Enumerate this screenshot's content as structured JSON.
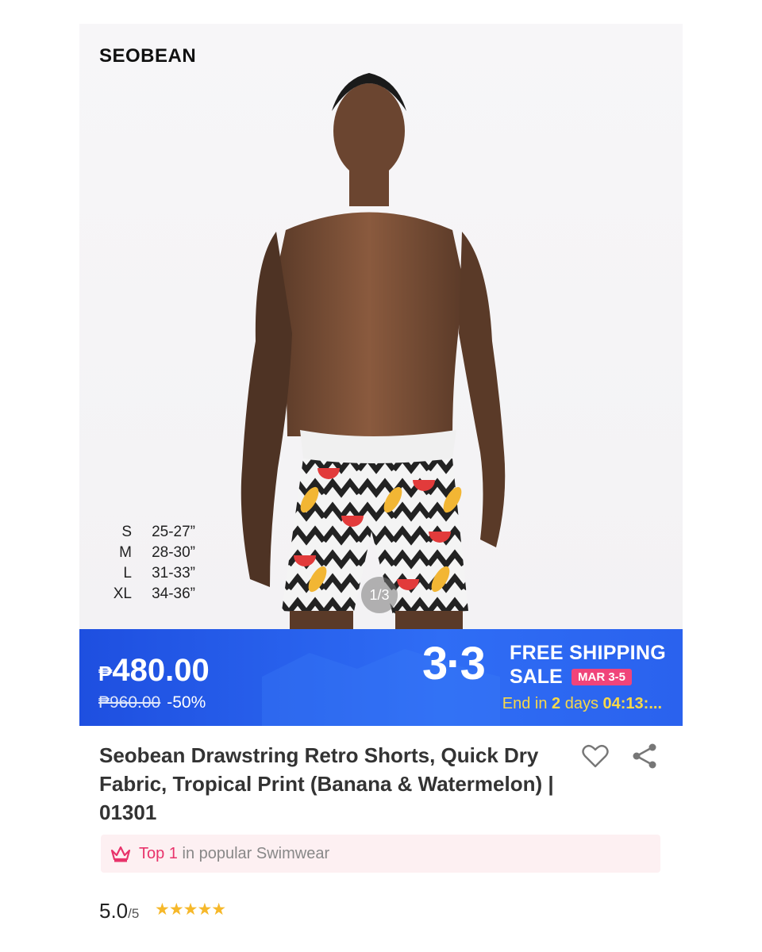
{
  "brand": "SEOBEAN",
  "image": {
    "pager": "1/3"
  },
  "size_chart": [
    {
      "size": "S",
      "inches": "25-27”"
    },
    {
      "size": "M",
      "inches": "28-30”"
    },
    {
      "size": "L",
      "inches": "31-33”"
    },
    {
      "size": "XL",
      "inches": "34-36”"
    }
  ],
  "sale": {
    "currency": "₱",
    "price": "480.00",
    "original_price": "₱960.00",
    "discount": "-50%",
    "campaign_number": "3·3",
    "campaign_line1": "FREE SHIPPING",
    "campaign_line2": "SALE",
    "campaign_dates": "MAR 3-5",
    "countdown_prefix": "End in",
    "countdown_days": "2",
    "countdown_days_label": "days",
    "countdown_time": "04:13:..."
  },
  "product": {
    "title": "Seobean Drawstring Retro Shorts, Quick Dry Fabric, Tropical Print (Banana & Watermelon) | 01301"
  },
  "ranking": {
    "highlight": "Top 1",
    "text": "in popular Swimwear"
  },
  "rating": {
    "score": "5.0",
    "denominator": "/5",
    "stars": "★★★★★"
  },
  "colors": {
    "sale_blue": "#2a62ee",
    "accent_pink": "#e8336b",
    "countdown_yellow": "#f7d84a",
    "star": "#f6b82a"
  }
}
